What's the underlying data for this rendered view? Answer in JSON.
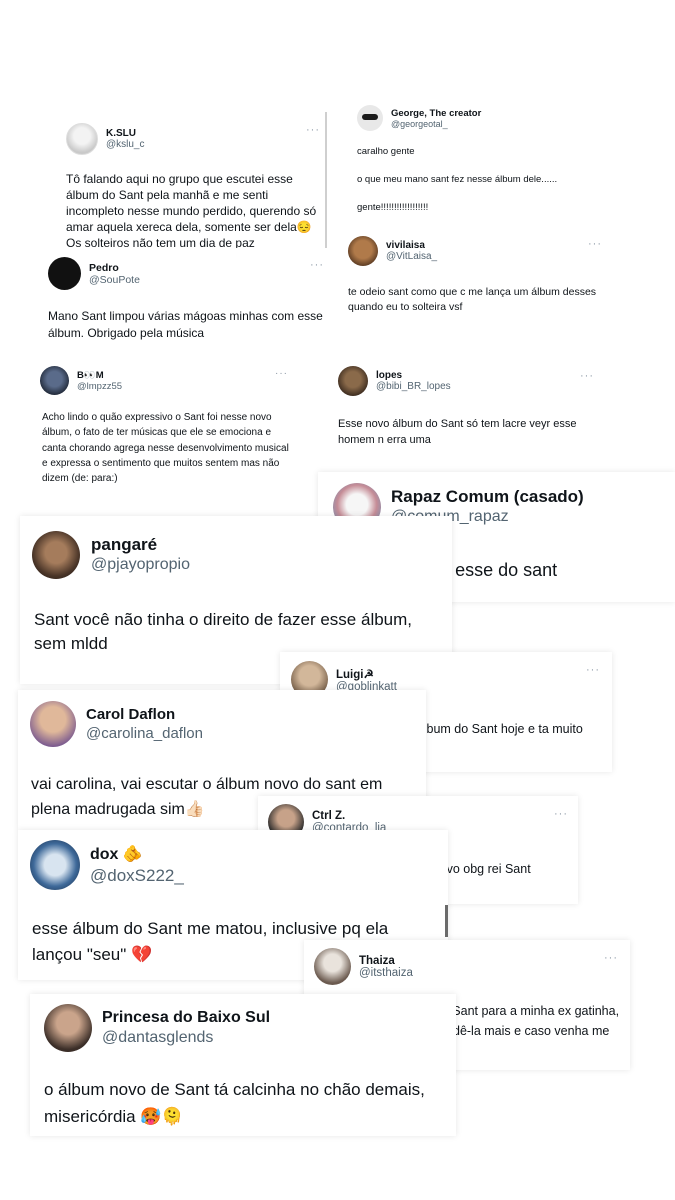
{
  "tweets": [
    {
      "name": "K.SLU",
      "handle": "@kslu_c",
      "text": "Tô falando aqui no grupo que escutei esse álbum do Sant pela manhã e me senti incompleto nesse mundo perdido, querendo só amar aquela xereca dela, somente ser dela😔Os solteiros não tem um dia de paz",
      "more": "···"
    },
    {
      "name": "George, The creator",
      "handle": "@georgeotal_",
      "line1": "caralho gente",
      "line2": "o que meu mano sant fez nesse álbum dele......",
      "line3": "gente!!!!!!!!!!!!!!!!!!",
      "more": "···"
    },
    {
      "name": "vivilaisa",
      "handle": "@VitLaisa_",
      "text": "te odeio sant como que c me lança um álbum desses quando eu to solteira vsf",
      "more": "···"
    },
    {
      "name": "Pedro",
      "handle": "@SouPote",
      "text": "Mano Sant limpou várias mágoas minhas com esse álbum. Obrigado pela música",
      "more": "···"
    },
    {
      "name": "B👀M",
      "handle": "@lmpzz55",
      "text": "Acho lindo o quão expressivo o Sant foi nesse novo álbum, o fato de ter músicas que ele se emociona e canta chorando agrega nesse desenvolvimento musical e expressa o sentimento que muitos sentem mas não dizem (de: para:)",
      "more": "···"
    },
    {
      "name": "lopes",
      "handle": "@bibi_BR_lopes",
      "text": "Esse novo álbum do Sant só tem lacre veyr esse homem n erra uma",
      "more": "···"
    },
    {
      "name": "Rapaz Comum (casado)",
      "handle": "@comum_rapaz",
      "text": "Álbum de puto esse do sant"
    },
    {
      "name": "pangaré",
      "handle": "@pjayopropio",
      "text": "Sant você não tinha o direito de fazer esse álbum, sem mldd"
    },
    {
      "name": "Luigi☭",
      "handle": "@goblinkatt",
      "text": "Parei pra ouvir o novo album do Sant hoje e ta muito gostoso mlk",
      "more": "···"
    },
    {
      "name": "Carol Daflon",
      "handle": "@carolina_daflon",
      "text": "vai carolina, vai escutar o álbum novo do sant em plena madrugada sim👍🏻"
    },
    {
      "name": "Ctrl Z.",
      "handle": "@contardo_lia",
      "text": "da p transa c todas do álbum novo obg rei Sant honrarei",
      "more": "···"
    },
    {
      "name": "dox 🫵",
      "handle": "@doxS222_",
      "text": "esse álbum do Sant me matou, inclusive pq ela lançou \"seu\" 💔"
    },
    {
      "name": "Thaiza",
      "handle": "@itsthaiza",
      "text": "Dedico o novo álbum do Sant para a minha ex gatinha, apesar de eu não respondê-la mais e caso venha me stalkear, é pra ti.",
      "more": "···"
    },
    {
      "name": "Princesa do Baixo Sul",
      "handle": "@dantasglends",
      "text": "o álbum novo de Sant tá calcinha no chão demais, misericórdia 🥵🫠"
    }
  ]
}
